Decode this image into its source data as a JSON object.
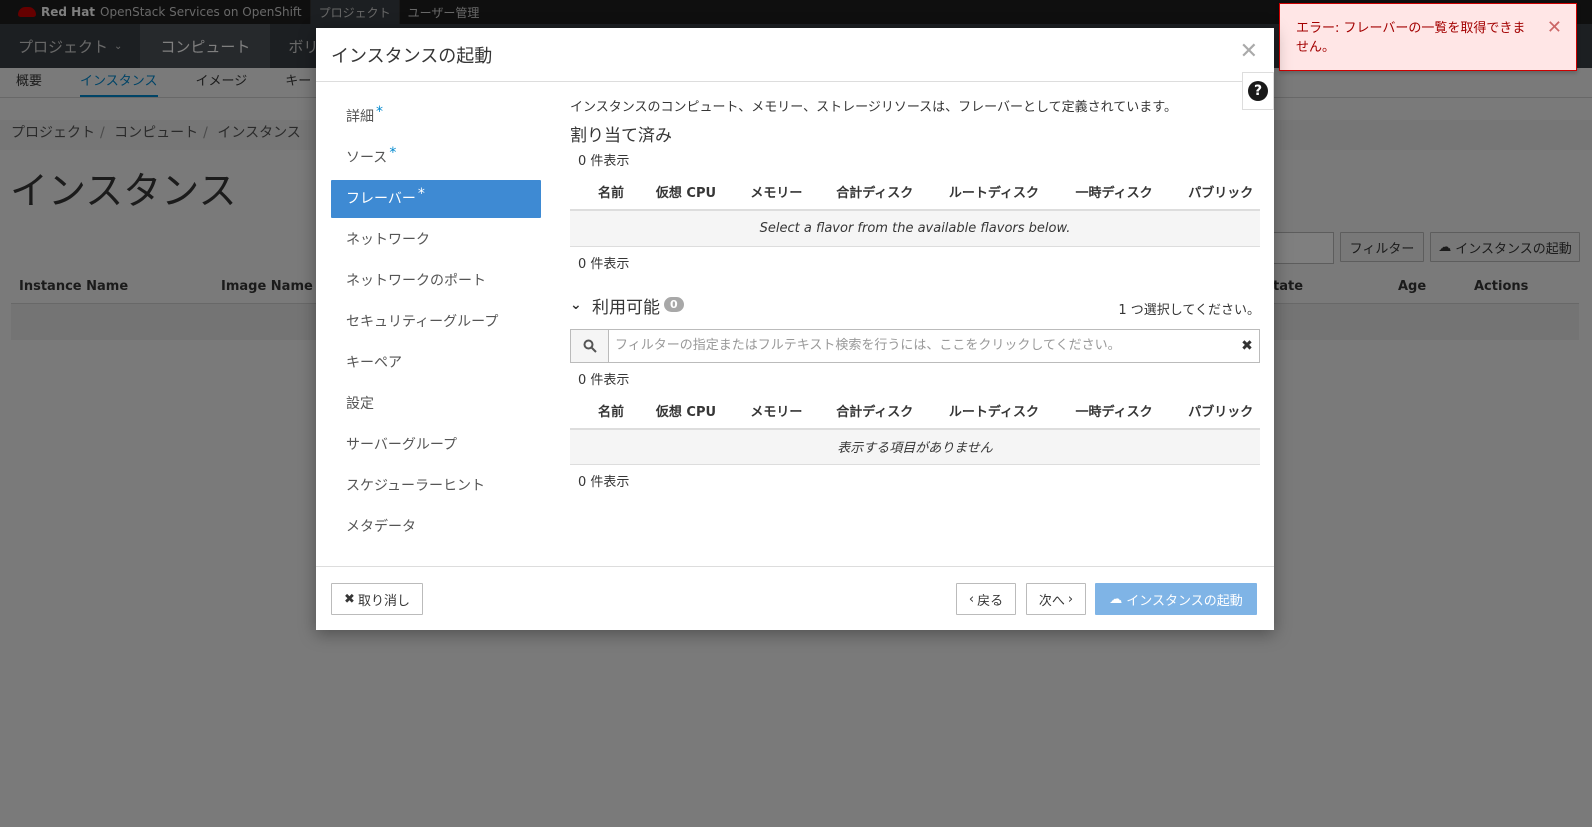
{
  "topbar": {
    "brand_strong": "Red Hat",
    "brand_text": "OpenStack Services on OpenShift",
    "nav": [
      "プロジェクト",
      "ユーザー管理"
    ]
  },
  "mainnav": {
    "project": "プロジェクト",
    "compute": "コンピュート",
    "volume": "ボリュー"
  },
  "subnav": [
    "概要",
    "インスタンス",
    "イメージ",
    "キー"
  ],
  "breadcrumb": [
    "プロジェクト",
    "コンピュート",
    "インスタンス"
  ],
  "page_title": "インスタンス",
  "page_actions": {
    "filter": "フィルター",
    "launch": "インスタンスの起動"
  },
  "table_headers": {
    "instance_name": "Instance Name",
    "image_name": "Image Name",
    "state": "tate",
    "age": "Age",
    "actions": "Actions"
  },
  "toast": {
    "message": "エラー: フレーバーの一覧を取得できません。"
  },
  "modal": {
    "title": "インスタンスの起動",
    "steps": [
      {
        "label": "詳細",
        "required": "*"
      },
      {
        "label": "ソース",
        "required": "*"
      },
      {
        "label": "フレーバー",
        "required": "*"
      },
      {
        "label": "ネットワーク",
        "required": ""
      },
      {
        "label": "ネットワークのポート",
        "required": ""
      },
      {
        "label": "セキュリティーグループ",
        "required": ""
      },
      {
        "label": "キーペア",
        "required": ""
      },
      {
        "label": "設定",
        "required": ""
      },
      {
        "label": "サーバーグループ",
        "required": ""
      },
      {
        "label": "スケジューラーヒント",
        "required": ""
      },
      {
        "label": "メタデータ",
        "required": ""
      }
    ],
    "intro": "インスタンスのコンピュート、メモリー、ストレージリソースは、フレーバーとして定義されています。",
    "allocated": {
      "title": "割り当て済み",
      "count_top": "0 件表示",
      "empty": "Select a flavor from the available flavors below.",
      "count_bottom": "0 件表示"
    },
    "columns": [
      "名前",
      "仮想 CPU",
      "メモリー",
      "合計ディスク",
      "ルートディスク",
      "一時ディスク",
      "パブリック"
    ],
    "available": {
      "title": "利用可能",
      "badge": "0",
      "pick_one": "1 つ選択してください。",
      "search_placeholder": "フィルターの指定またはフルテキスト検索を行うには、ここをクリックしてください。",
      "count_top": "0 件表示",
      "empty": "表示する項目がありません",
      "count_bottom": "0 件表示"
    },
    "footer": {
      "cancel": "取り消し",
      "back": "戻る",
      "next": "次へ",
      "launch": "インスタンスの起動"
    }
  },
  "colors": {
    "accent": "#3e8ad3",
    "link": "#0088ce",
    "error_text": "#a30000",
    "error_bg": "#ffe6e6",
    "primary_disabled": "#7fb4e6"
  }
}
